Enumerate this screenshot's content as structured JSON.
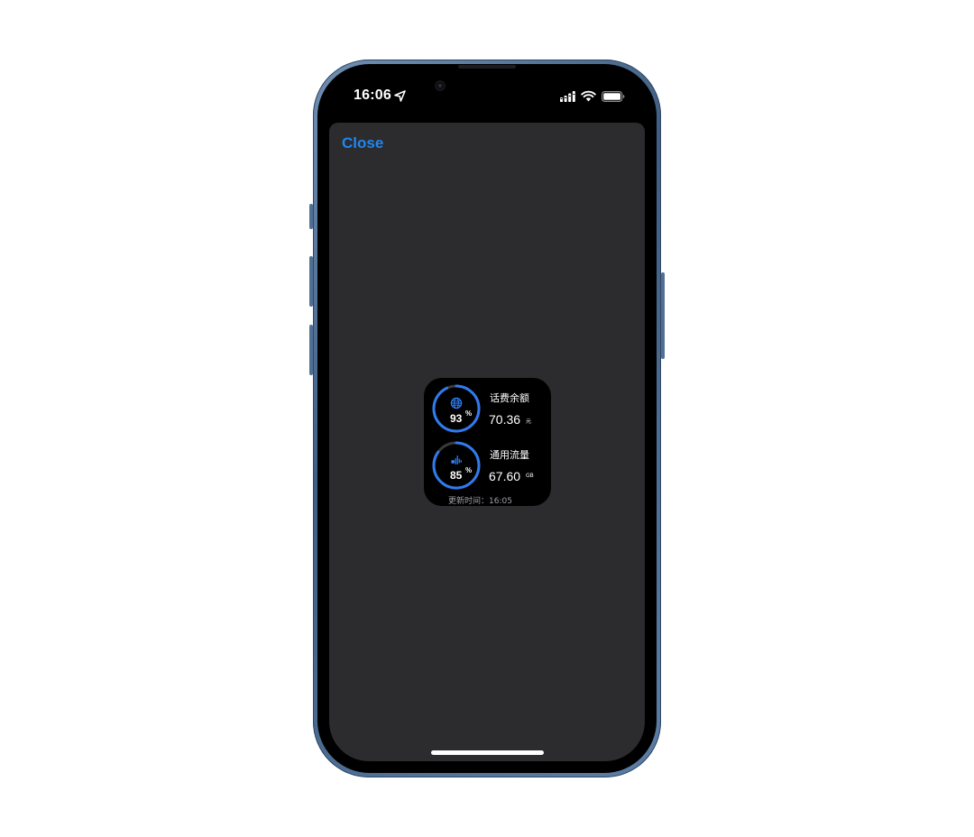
{
  "status_bar": {
    "time": "16:06",
    "location_icon": "location-arrow-icon",
    "signal_icon": "cellular-signal-icon",
    "wifi_icon": "wifi-icon",
    "battery_icon": "battery-icon"
  },
  "sheet": {
    "close_label": "Close"
  },
  "widget": {
    "accent_color": "#2f7bf0",
    "balance": {
      "icon": "globe-icon",
      "percent": "93",
      "percent_fraction": 0.93,
      "percent_unit": "%",
      "label": "话费余额",
      "value": "70.36",
      "unit": "元"
    },
    "data": {
      "icon": "data-flow-icon",
      "percent": "85",
      "percent_fraction": 0.85,
      "percent_unit": "%",
      "label": "通用流量",
      "value": "67.60",
      "unit": "GB"
    },
    "update": {
      "label": "更新时间：",
      "time": "16:05"
    }
  }
}
